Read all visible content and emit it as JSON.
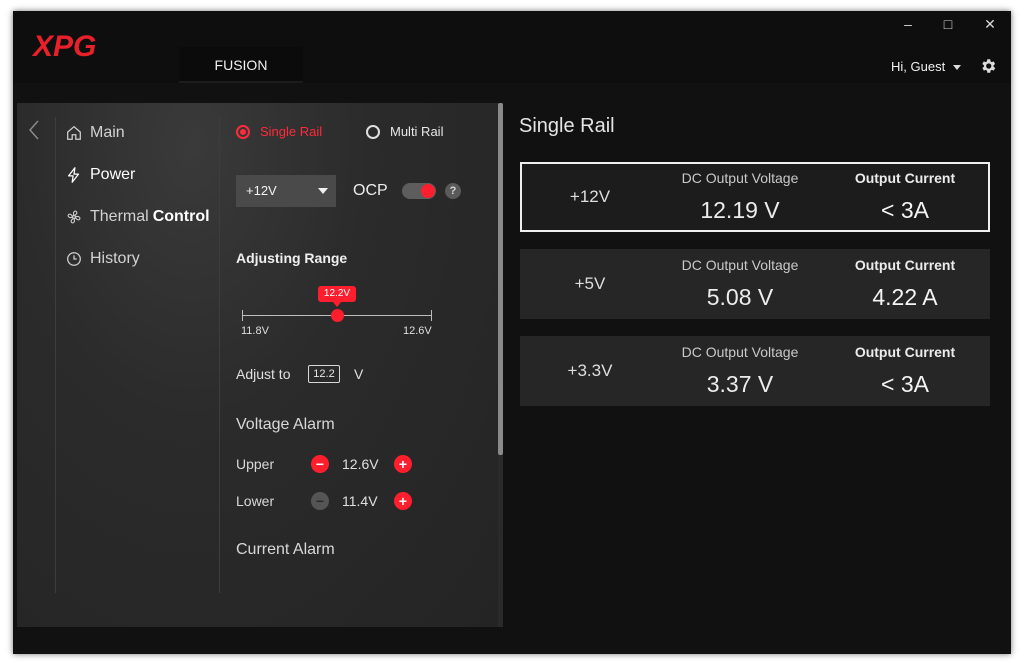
{
  "app": {
    "brand": "XPG",
    "nav_tab": "FUSION"
  },
  "window_controls": {
    "minimize": "–",
    "maximize": "□",
    "close": "✕"
  },
  "user": {
    "greeting": "Hi, Guest"
  },
  "sidebar": {
    "items": [
      {
        "label": "Main",
        "icon": "home-icon"
      },
      {
        "label": "Power",
        "icon": "lightning-icon"
      },
      {
        "label": "Thermal",
        "label_bold": "Control",
        "icon": "fan-icon"
      },
      {
        "label": "History",
        "icon": "history-icon"
      }
    ]
  },
  "power": {
    "rail_modes": {
      "single": "Single Rail",
      "multi": "Multi Rail",
      "selected": "single"
    },
    "rail_select": "+12V",
    "ocp": {
      "label": "OCP",
      "enabled": true,
      "help": "?"
    },
    "adjusting_range": {
      "title": "Adjusting Range",
      "min_label": "11.8V",
      "max_label": "12.6V",
      "min": 11.8,
      "max": 12.6,
      "value": 12.2,
      "value_label": "12.2V"
    },
    "adjust_to": {
      "label": "Adjust to",
      "value": "12.2",
      "unit": "V"
    },
    "voltage_alarm": {
      "title": "Voltage Alarm",
      "upper": {
        "label": "Upper",
        "value": "12.6V"
      },
      "lower": {
        "label": "Lower",
        "value": "11.4V"
      }
    },
    "current_alarm": {
      "title": "Current Alarm"
    }
  },
  "right": {
    "title": "Single Rail",
    "rails": [
      {
        "name": "+12V",
        "voltage_header": "DC Output Voltage",
        "voltage": "12.19 V",
        "current_header": "Output Current",
        "current": "< 3A",
        "selected": true
      },
      {
        "name": "+5V",
        "voltage_header": "DC Output Voltage",
        "voltage": "5.08 V",
        "current_header": "Output Current",
        "current": "4.22 A",
        "selected": false
      },
      {
        "name": "+3.3V",
        "voltage_header": "DC Output Voltage",
        "voltage": "3.37 V",
        "current_header": "Output Current",
        "current": "< 3A",
        "selected": false
      }
    ]
  },
  "colors": {
    "accent": "#ff1e2d",
    "panel": "#2b2b2b",
    "background": "#111111"
  }
}
